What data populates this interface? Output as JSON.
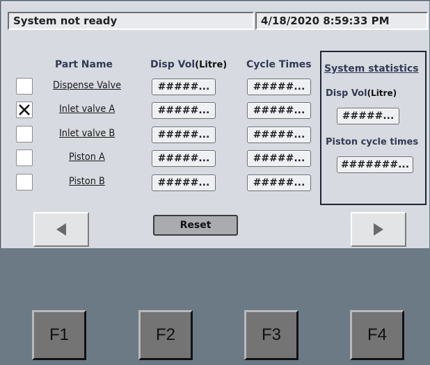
{
  "status_bar": {
    "message": "System not ready",
    "datetime": "4/18/2020 8:59:33 PM"
  },
  "table": {
    "headers": {
      "part_name": "Part Name",
      "disp_vol": "Disp Vol",
      "disp_vol_unit": "(Litre)",
      "cycle_times": "Cycle Times"
    },
    "rows": [
      {
        "name": "Dispense Valve",
        "checked": false,
        "disp_vol": "#####...",
        "cycle_times": "#####..."
      },
      {
        "name": "Inlet valve A",
        "checked": true,
        "disp_vol": "#####...",
        "cycle_times": "#####..."
      },
      {
        "name": "Inlet valve B",
        "checked": false,
        "disp_vol": "#####...",
        "cycle_times": "#####..."
      },
      {
        "name": "Piston A",
        "checked": false,
        "disp_vol": "#####...",
        "cycle_times": "#####..."
      },
      {
        "name": "Piston B",
        "checked": false,
        "disp_vol": "#####...",
        "cycle_times": "#####..."
      }
    ]
  },
  "stats": {
    "title": "System statistics",
    "disp_vol_label": "Disp Vol",
    "disp_vol_unit": "(Litre)",
    "disp_vol_value": "#####...",
    "piston_label": "Piston cycle times",
    "piston_value": "#######..."
  },
  "nav": {
    "prev_icon": "triangle-left-icon",
    "next_icon": "triangle-right-icon",
    "reset_label": "Reset"
  },
  "function_keys": [
    "F1",
    "F2",
    "F3",
    "F4"
  ],
  "colors": {
    "panel_bg": "#d7dae0",
    "screen_bg": "#6c7a86",
    "label_color": "#333b55"
  }
}
